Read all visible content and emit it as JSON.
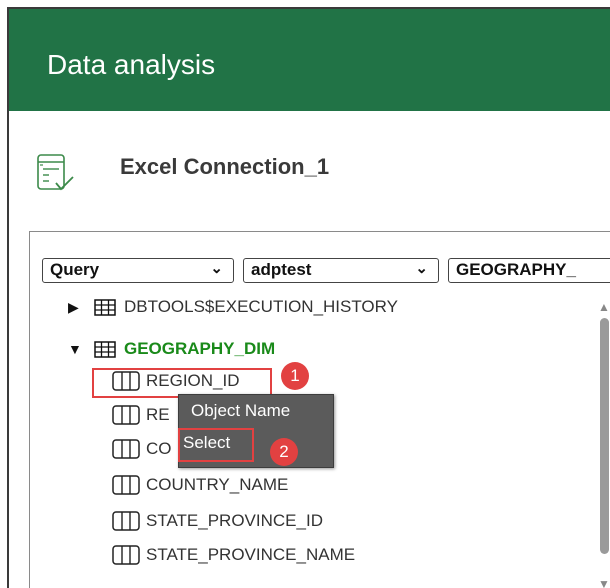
{
  "app": {
    "title": "Data analysis"
  },
  "connection": {
    "name": "Excel Connection_1",
    "icon": "connection-list-icon"
  },
  "selectors": [
    {
      "value": "Query"
    },
    {
      "value": "adptest"
    },
    {
      "value": "GEOGRAPHY_"
    }
  ],
  "tree": {
    "items": [
      {
        "label": "DBTOOLS$EXECUTION_HISTORY",
        "type": "table",
        "expanded": false
      },
      {
        "label": "GEOGRAPHY_DIM",
        "type": "table",
        "expanded": true
      },
      {
        "label": "REGION_ID",
        "type": "column"
      },
      {
        "label": "RE",
        "type": "column"
      },
      {
        "label": "CO",
        "type": "column"
      },
      {
        "label": "COUNTRY_NAME",
        "type": "column"
      },
      {
        "label": "STATE_PROVINCE_ID",
        "type": "column"
      },
      {
        "label": "STATE_PROVINCE_NAME",
        "type": "column"
      }
    ]
  },
  "context_menu": {
    "items": [
      {
        "label": "Object Name"
      },
      {
        "label": "Select"
      }
    ]
  },
  "callouts": [
    {
      "number": "1"
    },
    {
      "number": "2"
    }
  ],
  "colors": {
    "header": "#217346",
    "highlight": "#e24141",
    "table_open": "#1a8a1a",
    "menu_bg": "#5b5b5b"
  }
}
